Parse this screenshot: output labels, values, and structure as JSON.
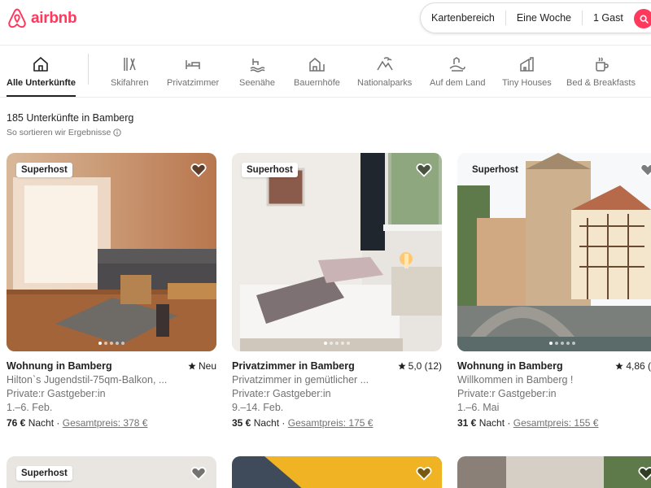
{
  "header": {
    "brand": "airbnb",
    "search": {
      "area": "Kartenbereich",
      "dates": "Eine Woche",
      "guests": "1 Gast"
    }
  },
  "categories": [
    {
      "label": "Alle Unterkünfte",
      "icon": "house-icon"
    },
    {
      "label": "Skifahren",
      "icon": "ski-icon"
    },
    {
      "label": "Privatzimmer",
      "icon": "bed-icon"
    },
    {
      "label": "Seenähe",
      "icon": "lake-icon"
    },
    {
      "label": "Bauernhöfe",
      "icon": "barn-icon"
    },
    {
      "label": "Nationalparks",
      "icon": "mountain-icon"
    },
    {
      "label": "Auf dem Land",
      "icon": "countryside-icon"
    },
    {
      "label": "Tiny Houses",
      "icon": "tiny-house-icon"
    },
    {
      "label": "Bed & Breakfasts",
      "icon": "coffee-icon"
    }
  ],
  "results": {
    "count": "185 Unterkünfte in Bamberg",
    "sort_info": "So sortieren wir Ergebnisse"
  },
  "listings": [
    {
      "badge": "Superhost",
      "title": "Wohnung in Bamberg",
      "rating": "Neu",
      "description": "Hilton`s Jugendstil-75qm-Balkon, ...",
      "host": "Private:r Gastgeber:in",
      "dates": "1.–6. Feb.",
      "price": "76 €",
      "per": "Nacht",
      "total": "Gesamtpreis: 378 €"
    },
    {
      "badge": "Superhost",
      "title": "Privatzimmer in Bamberg",
      "rating": "5,0 (12)",
      "description": "Privatzimmer in gemütlicher ...",
      "host": "Private:r Gastgeber:in",
      "dates": "9.–14. Feb.",
      "price": "35 €",
      "per": "Nacht",
      "total": "Gesamtpreis: 175 €"
    },
    {
      "badge": "Superhost",
      "title": "Wohnung in Bamberg",
      "rating": "4,86 (",
      "description": "Willkommen in Bamberg !",
      "host": "Private:r Gastgeber:in",
      "dates": "1.–6. Mai",
      "price": "31 €",
      "per": "Nacht",
      "total": "Gesamtpreis: 155 €"
    }
  ],
  "second_row": [
    {
      "badge": "Superhost"
    }
  ],
  "colors": {
    "brand": "#ff385c",
    "text": "#222222",
    "muted": "#717171"
  }
}
